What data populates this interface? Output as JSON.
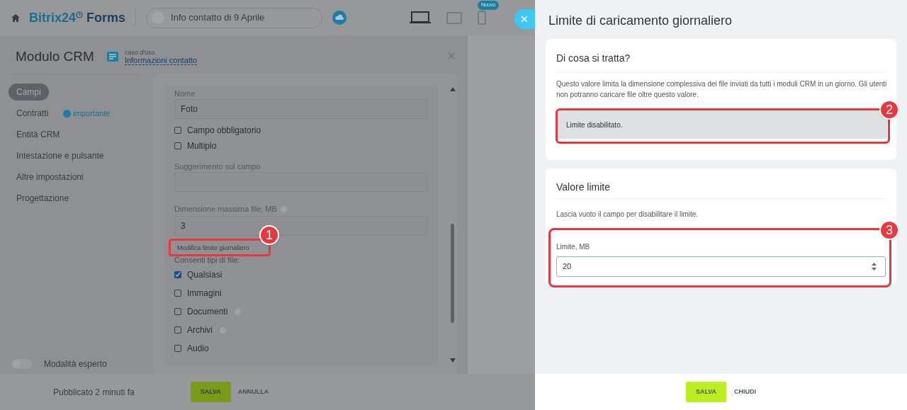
{
  "header": {
    "logo": "Bitrix24",
    "logo_suffix": "Forms",
    "form_name": "Info contatto di 9 Aprile",
    "devices": [
      {
        "kind": "laptop",
        "selected": true
      },
      {
        "kind": "tablet",
        "selected": false
      },
      {
        "kind": "phone",
        "selected": false,
        "badge": "Nuovo"
      }
    ]
  },
  "module": {
    "title": "Modulo CRM",
    "use_case_label": "caso d'uso",
    "use_case_link": "Informazioni contatto"
  },
  "sidebar": {
    "items": [
      {
        "label": "Campi",
        "selected": true
      },
      {
        "label": "Contratti",
        "selected": false,
        "badge": "importante"
      },
      {
        "label": "Entità CRM",
        "selected": false
      },
      {
        "label": "Intestazione e pulsante",
        "selected": false
      },
      {
        "label": "Altre impostazioni",
        "selected": false
      },
      {
        "label": "Progettazione",
        "selected": false
      }
    ]
  },
  "expert_mode": {
    "label": "Modalità esperto",
    "on": false
  },
  "field_editor": {
    "name_label": "Nome",
    "name_value": "Foto",
    "options": [
      {
        "label": "Campo obbligatorio",
        "checked": false
      },
      {
        "label": "Multiplo",
        "checked": false
      }
    ],
    "hint_label": "Suggerimento sul campo",
    "size_label": "Dimensione massima file, MB",
    "size_value": "3",
    "daily_limit_link": "Modifica limite giornaliero",
    "callout": "1",
    "types_label": "Consenti tipi di file:",
    "types": [
      {
        "label": "Qualsiasi",
        "checked": true,
        "help": false
      },
      {
        "label": "Immagini",
        "checked": false,
        "help": false
      },
      {
        "label": "Documenti",
        "checked": false,
        "help": true
      },
      {
        "label": "Archivi",
        "checked": false,
        "help": true
      },
      {
        "label": "Audio",
        "checked": false,
        "help": false
      }
    ]
  },
  "footer": {
    "status": "Pubblicato 2 minuti fa",
    "save": "SALVA",
    "cancel": "ANNULLA"
  },
  "drawer": {
    "title": "Limite di caricamento giornaliero",
    "about": {
      "title": "Di cosa si tratta?",
      "text": "Questo valore limita la dimensione complessiva dei file inviati da tutti i moduli CRM in un giorno. Gli utenti non potranno caricare file oltre questo valore.",
      "notice": "Limite disabilitato.",
      "callout": "2"
    },
    "limit": {
      "title": "Valore limite",
      "text": "Lascia vuoto il campo per disabilitare il limite.",
      "field_label": "Limite, MB",
      "value": "20",
      "callout": "3"
    },
    "save": "SALVA",
    "close": "CHIUDI"
  }
}
